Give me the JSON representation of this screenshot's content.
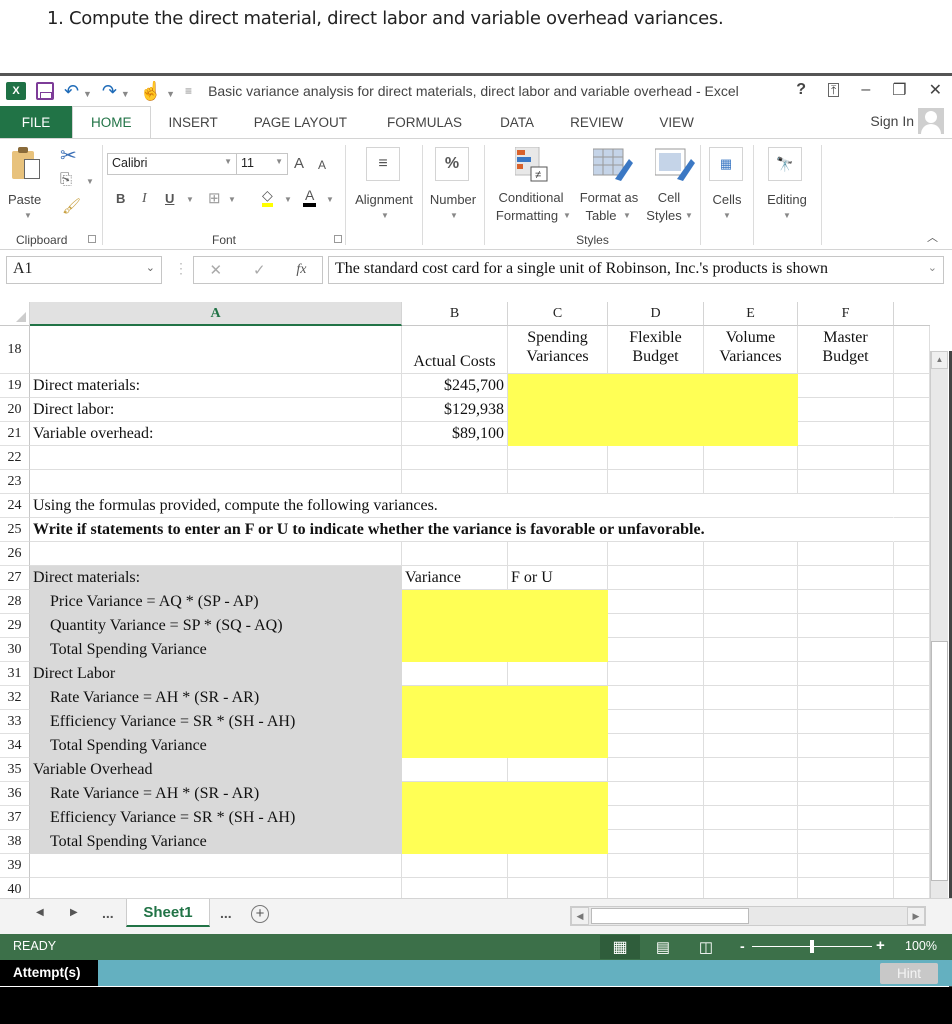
{
  "question": "1. Compute the direct material, direct labor and variable overhead variances.",
  "window": {
    "title": "Basic variance analysis for direct materials, direct labor and variable overhead - Excel",
    "app_icon": "excel-icon",
    "quick_access": [
      "save-icon",
      "undo-icon",
      "redo-icon",
      "touch-mode-icon",
      "customize-icon"
    ],
    "controls": {
      "help": "?",
      "ribbon_display": "ribbon-display-icon",
      "minimize": "–",
      "restore": "🗗",
      "close": "✕"
    }
  },
  "tabs": [
    {
      "label": "FILE"
    },
    {
      "label": "HOME",
      "active": true
    },
    {
      "label": "INSERT"
    },
    {
      "label": "PAGE LAYOUT"
    },
    {
      "label": "FORMULAS"
    },
    {
      "label": "DATA"
    },
    {
      "label": "REVIEW"
    },
    {
      "label": "VIEW"
    }
  ],
  "sign_in": "Sign In",
  "ribbon": {
    "clipboard": {
      "paste": "Paste",
      "group": "Clipboard"
    },
    "font": {
      "name": "Calibri",
      "size": "11",
      "bold": "B",
      "italic": "I",
      "underline": "U",
      "grow": "A",
      "shrink": "A",
      "font_color": "A",
      "group": "Font",
      "highlight_color": "#ffff00",
      "text_color": "#000000"
    },
    "alignment": {
      "label": "Alignment"
    },
    "number": {
      "label": "Number",
      "icon_text": "%"
    },
    "styles": {
      "conditional_1": "Conditional",
      "conditional_2": "Formatting",
      "format_table_1": "Format as",
      "format_table_2": "Table",
      "cell_styles_1": "Cell",
      "cell_styles_2": "Styles",
      "group": "Styles"
    },
    "cells": {
      "label": "Cells"
    },
    "editing": {
      "label": "Editing"
    }
  },
  "formula_bar": {
    "name_box": "A1",
    "cancel": "✕",
    "enter": "✓",
    "fx": "fx",
    "content": "The standard cost card for a single unit of Robinson, Inc.'s products is shown"
  },
  "columns": [
    "A",
    "B",
    "C",
    "D",
    "E",
    "F"
  ],
  "selected_column": "A",
  "rows": {
    "r18": {
      "num": "18",
      "B": "Actual Costs",
      "C": "Spending Variances",
      "D": "Flexible Budget",
      "E": "Volume Variances",
      "F": "Master Budget"
    },
    "r19": {
      "num": "19",
      "A": "Direct materials:",
      "B": "$245,700"
    },
    "r20": {
      "num": "20",
      "A": "Direct labor:",
      "B": "$129,938"
    },
    "r21": {
      "num": "21",
      "A": "Variable overhead:",
      "B": "$89,100"
    },
    "r22": {
      "num": "22"
    },
    "r23": {
      "num": "23"
    },
    "r24": {
      "num": "24",
      "A": "Using the formulas provided, compute the following variances."
    },
    "r25": {
      "num": "25",
      "A": "Write if statements to enter an  F or U to indicate whether the variance is favorable or unfavorable."
    },
    "r26": {
      "num": "26"
    },
    "r27": {
      "num": "27",
      "A": "Direct materials:",
      "B": "Variance",
      "C": "F or U"
    },
    "r28": {
      "num": "28",
      "A": "Price Variance = AQ * (SP - AP)"
    },
    "r29": {
      "num": "29",
      "A": "Quantity Variance = SP * (SQ - AQ)"
    },
    "r30": {
      "num": "30",
      "A": "Total Spending Variance"
    },
    "r31": {
      "num": "31",
      "A": "Direct Labor"
    },
    "r32": {
      "num": "32",
      "A": "Rate Variance = AH * (SR - AR)"
    },
    "r33": {
      "num": "33",
      "A": "Efficiency Variance = SR * (SH - AH)"
    },
    "r34": {
      "num": "34",
      "A": "Total Spending Variance"
    },
    "r35": {
      "num": "35",
      "A": "Variable Overhead"
    },
    "r36": {
      "num": "36",
      "A": "Rate Variance = AH * (SR - AR)"
    },
    "r37": {
      "num": "37",
      "A": "Efficiency Variance = SR * (SH - AH)"
    },
    "r38": {
      "num": "38",
      "A": "Total Spending Variance"
    },
    "r39": {
      "num": "39"
    },
    "r40": {
      "num": "40"
    }
  },
  "colors": {
    "input_fill": "#ffff55",
    "label_fill": "#d9d9d9",
    "excel_green": "#217346",
    "status_green": "#3c7049",
    "attempt_bar": "#64b0c0"
  },
  "sheet_tabs": {
    "active": "Sheet1",
    "ellipsis": "..."
  },
  "status": {
    "ready": "READY",
    "zoom": "100%",
    "zoom_minus": "-",
    "zoom_plus": "+"
  },
  "attempt": {
    "label": "Attempt(s)",
    "hint": "Hint"
  }
}
